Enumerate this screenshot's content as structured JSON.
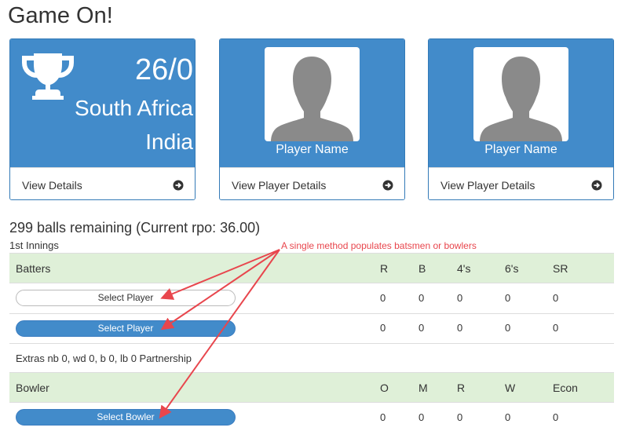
{
  "page": {
    "title": "Game On!"
  },
  "score_card": {
    "score": "26/0",
    "batting_team": "South Africa",
    "bowling_team": "India",
    "footer_label": "View Details",
    "trophy_icon": "trophy-icon",
    "footer_icon": "arrow-circle-right-icon"
  },
  "player_cards": [
    {
      "name": "Player Name",
      "footer_label": "View Player Details"
    },
    {
      "name": "Player Name",
      "footer_label": "View Player Details"
    }
  ],
  "status": {
    "balls_remaining": "299 balls remaining (Current rpo: 36.00)",
    "innings": "1st Innings"
  },
  "batters": {
    "header": [
      "Batters",
      "R",
      "B",
      "4's",
      "6's",
      "SR"
    ],
    "rows": [
      {
        "player": "Select Player",
        "values": [
          "0",
          "0",
          "0",
          "0",
          "0"
        ]
      },
      {
        "player": "Select Player",
        "values": [
          "0",
          "0",
          "0",
          "0",
          "0"
        ]
      }
    ]
  },
  "extras": "Extras nb 0, wd 0, b 0, lb 0 Partnership",
  "bowlers": {
    "header": [
      "Bowler",
      "O",
      "M",
      "R",
      "W",
      "Econ"
    ],
    "rows": [
      {
        "player": "Select Bowler",
        "values": [
          "0",
          "0",
          "0",
          "0",
          "0"
        ]
      }
    ]
  },
  "annotation": "A single method populates batsmen or bowlers",
  "colors": {
    "card_blue": "#428bca",
    "header_green": "#dff0d8",
    "annotation_red": "#e8464d"
  }
}
